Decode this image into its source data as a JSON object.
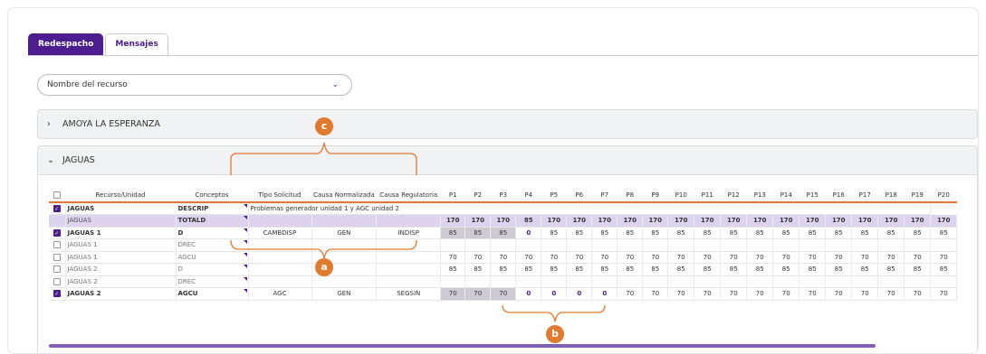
{
  "tabs": [
    {
      "label": "Redespacho",
      "active": true
    },
    {
      "label": "Mensajes",
      "active": false
    }
  ],
  "resource_select": {
    "value": "Nombre del recurso"
  },
  "groups": [
    {
      "name": "AMOYA LA ESPERANZA",
      "expanded": false
    },
    {
      "name": "JAGUAS",
      "expanded": true
    }
  ],
  "table": {
    "headers": [
      "Recurso/Unidad",
      "Conceptos",
      "Tipo Solicitud",
      "Causa Normalizada",
      "Causa Regulatoria",
      "P1",
      "P2",
      "P3",
      "P4",
      "P5",
      "P6",
      "P7",
      "P8",
      "P9",
      "P10",
      "P11",
      "P12",
      "P13",
      "P14",
      "P15",
      "P16",
      "P17",
      "P18",
      "P19",
      "P20"
    ],
    "rows": [
      {
        "checked": true,
        "unit": "JAGUAS",
        "concept": "DESCRIP",
        "desc": "Problemas generador unidad 1 y AGC unidad 2",
        "bold": true
      },
      {
        "checked": null,
        "unit": "JAGUAS",
        "concept": "TOTALD",
        "tipo": "",
        "causa": "",
        "reg": "",
        "values": [
          "170",
          "170",
          "170",
          "85",
          "170",
          "170",
          "170",
          "170",
          "170",
          "170",
          "170",
          "170",
          "170",
          "170",
          "170",
          "170",
          "170",
          "170",
          "170",
          "170"
        ],
        "total": true
      },
      {
        "checked": true,
        "unit": "JAGUAS 1",
        "concept": "D",
        "tipo": "CAMBDISP",
        "causa": "GEN",
        "reg": "INDISP",
        "values": [
          "85",
          "85",
          "85",
          "0",
          "85",
          "85",
          "85",
          "85",
          "85",
          "85",
          "85",
          "85",
          "85",
          "85",
          "85",
          "85",
          "85",
          "85",
          "85",
          "85"
        ],
        "bold": true
      },
      {
        "checked": false,
        "unit": "JAGUAS 1",
        "concept": "DREC",
        "tipo": "",
        "causa": "",
        "reg": "",
        "values": [
          "",
          "",
          "",
          "",
          "",
          "",
          "",
          "",
          "",
          "",
          "",
          "",
          "",
          "",
          "",
          "",
          "",
          "",
          "",
          ""
        ]
      },
      {
        "checked": false,
        "unit": "JAGUAS 1",
        "concept": "AGCU",
        "tipo": "",
        "causa": "",
        "reg": "",
        "values": [
          "70",
          "70",
          "70",
          "70",
          "70",
          "70",
          "70",
          "70",
          "70",
          "70",
          "70",
          "70",
          "70",
          "70",
          "70",
          "70",
          "70",
          "70",
          "70",
          "70"
        ]
      },
      {
        "checked": false,
        "unit": "JAGUAS 2",
        "concept": "D",
        "tipo": "",
        "causa": "",
        "reg": "",
        "values": [
          "85",
          "85",
          "85",
          "85",
          "85",
          "85",
          "85",
          "85",
          "85",
          "85",
          "85",
          "85",
          "85",
          "85",
          "85",
          "85",
          "85",
          "85",
          "85",
          "85"
        ]
      },
      {
        "checked": false,
        "unit": "JAGUAS 2",
        "concept": "DREC",
        "tipo": "",
        "causa": "",
        "reg": "",
        "values": [
          "",
          "",
          "",
          "",
          "",
          "",
          "",
          "",
          "",
          "",
          "",
          "",
          "",
          "",
          "",
          "",
          "",
          "",
          "",
          ""
        ]
      },
      {
        "checked": true,
        "unit": "JAGUAS 2",
        "concept": "AGCU",
        "tipo": "AGC",
        "causa": "GEN",
        "reg": "SEGSIN",
        "values": [
          "70",
          "70",
          "70",
          "0",
          "0",
          "0",
          "0",
          "70",
          "70",
          "70",
          "70",
          "70",
          "70",
          "70",
          "70",
          "70",
          "70",
          "70",
          "70",
          "70"
        ],
        "bold": true
      }
    ]
  },
  "callouts": [
    "c",
    "a",
    "b"
  ],
  "colors": {
    "accent": "#4b1d8e",
    "callout": "#e07a2e",
    "total_row": "#ddd3ee"
  }
}
